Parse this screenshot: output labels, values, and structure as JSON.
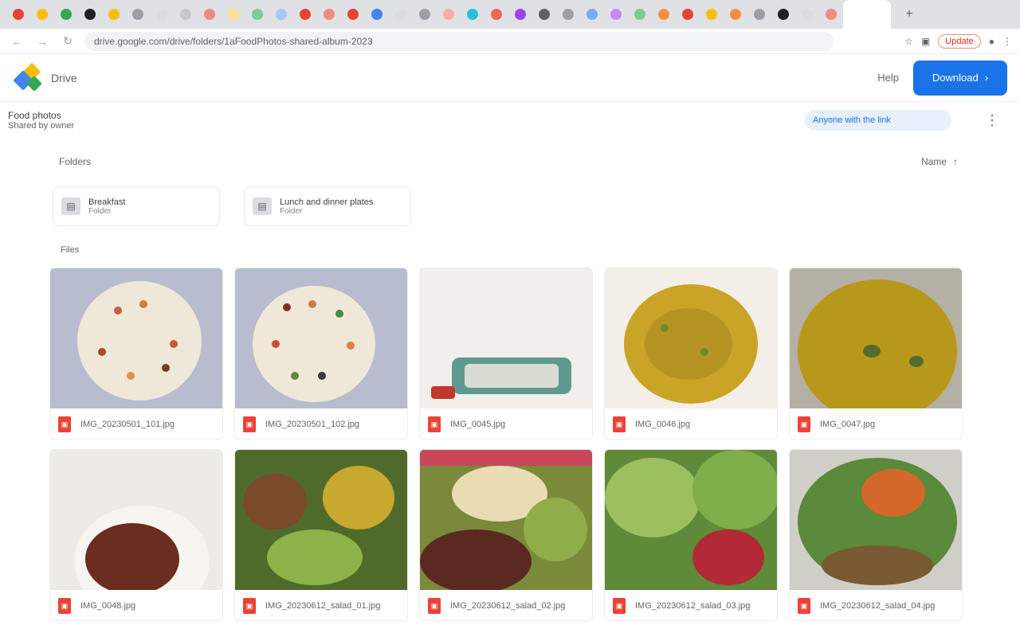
{
  "browser": {
    "tab_colors": [
      "#ea4335",
      "#fbbc04",
      "#34a853",
      "#202124",
      "#fbbc04",
      "#9aa0a6",
      "#dadce0",
      "#c5c8cc",
      "#f28b82",
      "#fde293",
      "#81c995",
      "#a8c7fa",
      "#ea4335",
      "#f28b82",
      "#ea4335",
      "#4285f4",
      "#dadce0",
      "#9aa0a6",
      "#f6aea9",
      "#24c1e0",
      "#ee675c",
      "#a142f4",
      "#5f6368",
      "#9aa0a6",
      "#7baaf7",
      "#c58af9",
      "#81c995",
      "#fa903e",
      "#ea4335",
      "#fbbc04",
      "#fa903e",
      "#9aa0a6",
      "#202124",
      "#dadce0",
      "#f28b82"
    ],
    "new_tab": "+",
    "back_icon": "←",
    "forward_icon": "→",
    "reload_icon": "↻",
    "url": "drive.google.com/drive/folders/1aFoodPhotos-shared-album-2023",
    "badge": "Update"
  },
  "header": {
    "app_name": "Drive",
    "help": "Help",
    "primary_button": "Download"
  },
  "subbar": {
    "title": "Food photos",
    "owner": "Shared by owner",
    "share_field": "Anyone with the link",
    "more": "⋮"
  },
  "main": {
    "folders_label": "Folders",
    "sort_label": "Name",
    "sort_arrow": "↑",
    "folders": [
      {
        "name": "Breakfast",
        "meta": "Folder"
      },
      {
        "name": "Lunch and dinner plates",
        "meta": "Folder"
      }
    ],
    "files_label": "Files",
    "files": [
      {
        "name": "IMG_20230501_101.jpg"
      },
      {
        "name": "IMG_20230501_102.jpg"
      },
      {
        "name": "IMG_0045.jpg"
      },
      {
        "name": "IMG_0046.jpg"
      },
      {
        "name": "IMG_0047.jpg"
      },
      {
        "name": "IMG_0048.jpg"
      },
      {
        "name": "IMG_20230612_salad_01.jpg"
      },
      {
        "name": "IMG_20230612_salad_02.jpg"
      },
      {
        "name": "IMG_20230612_salad_03.jpg"
      },
      {
        "name": "IMG_20230612_salad_04.jpg"
      }
    ]
  }
}
